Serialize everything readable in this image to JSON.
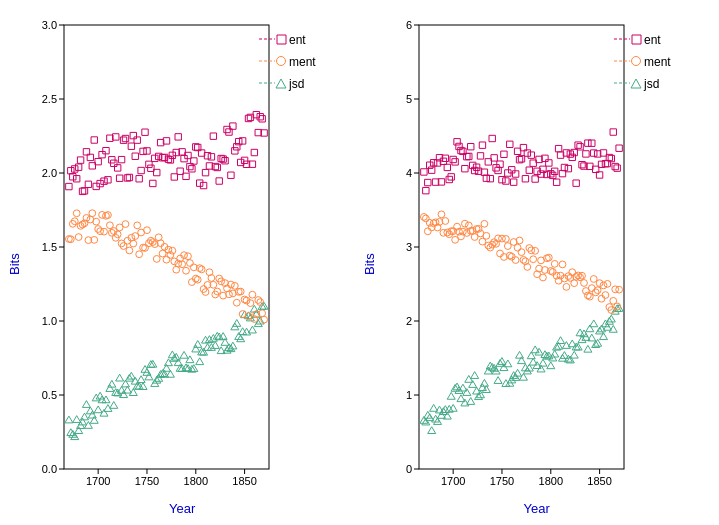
{
  "charts": [
    {
      "id": "chart1",
      "yLabel": "Bits",
      "xLabel": "Year",
      "yMin": 0.0,
      "yMax": 3.0,
      "yTicks": [
        0.0,
        0.5,
        1.0,
        1.5,
        2.0,
        2.5,
        3.0
      ],
      "xTicks": [
        1700,
        1750,
        1800,
        1850
      ],
      "xMin": 1665,
      "xMax": 1875,
      "legend": [
        {
          "label": "ent",
          "color": "#cc0066",
          "shape": "square"
        },
        {
          "label": "ment",
          "color": "#ff8844",
          "shape": "circle"
        },
        {
          "label": "jsd",
          "color": "#44aa88",
          "shape": "triangle"
        }
      ]
    },
    {
      "id": "chart2",
      "yLabel": "Bits",
      "xLabel": "Year",
      "yMin": 0,
      "yMax": 6,
      "yTicks": [
        0,
        1,
        2,
        3,
        4,
        5,
        6
      ],
      "xTicks": [
        1700,
        1750,
        1800,
        1850
      ],
      "xMin": 1665,
      "xMax": 1875,
      "legend": [
        {
          "label": "ent",
          "color": "#cc0066",
          "shape": "square"
        },
        {
          "label": "ment",
          "color": "#ff8844",
          "shape": "circle"
        },
        {
          "label": "jsd",
          "color": "#44aa88",
          "shape": "triangle"
        }
      ]
    }
  ]
}
